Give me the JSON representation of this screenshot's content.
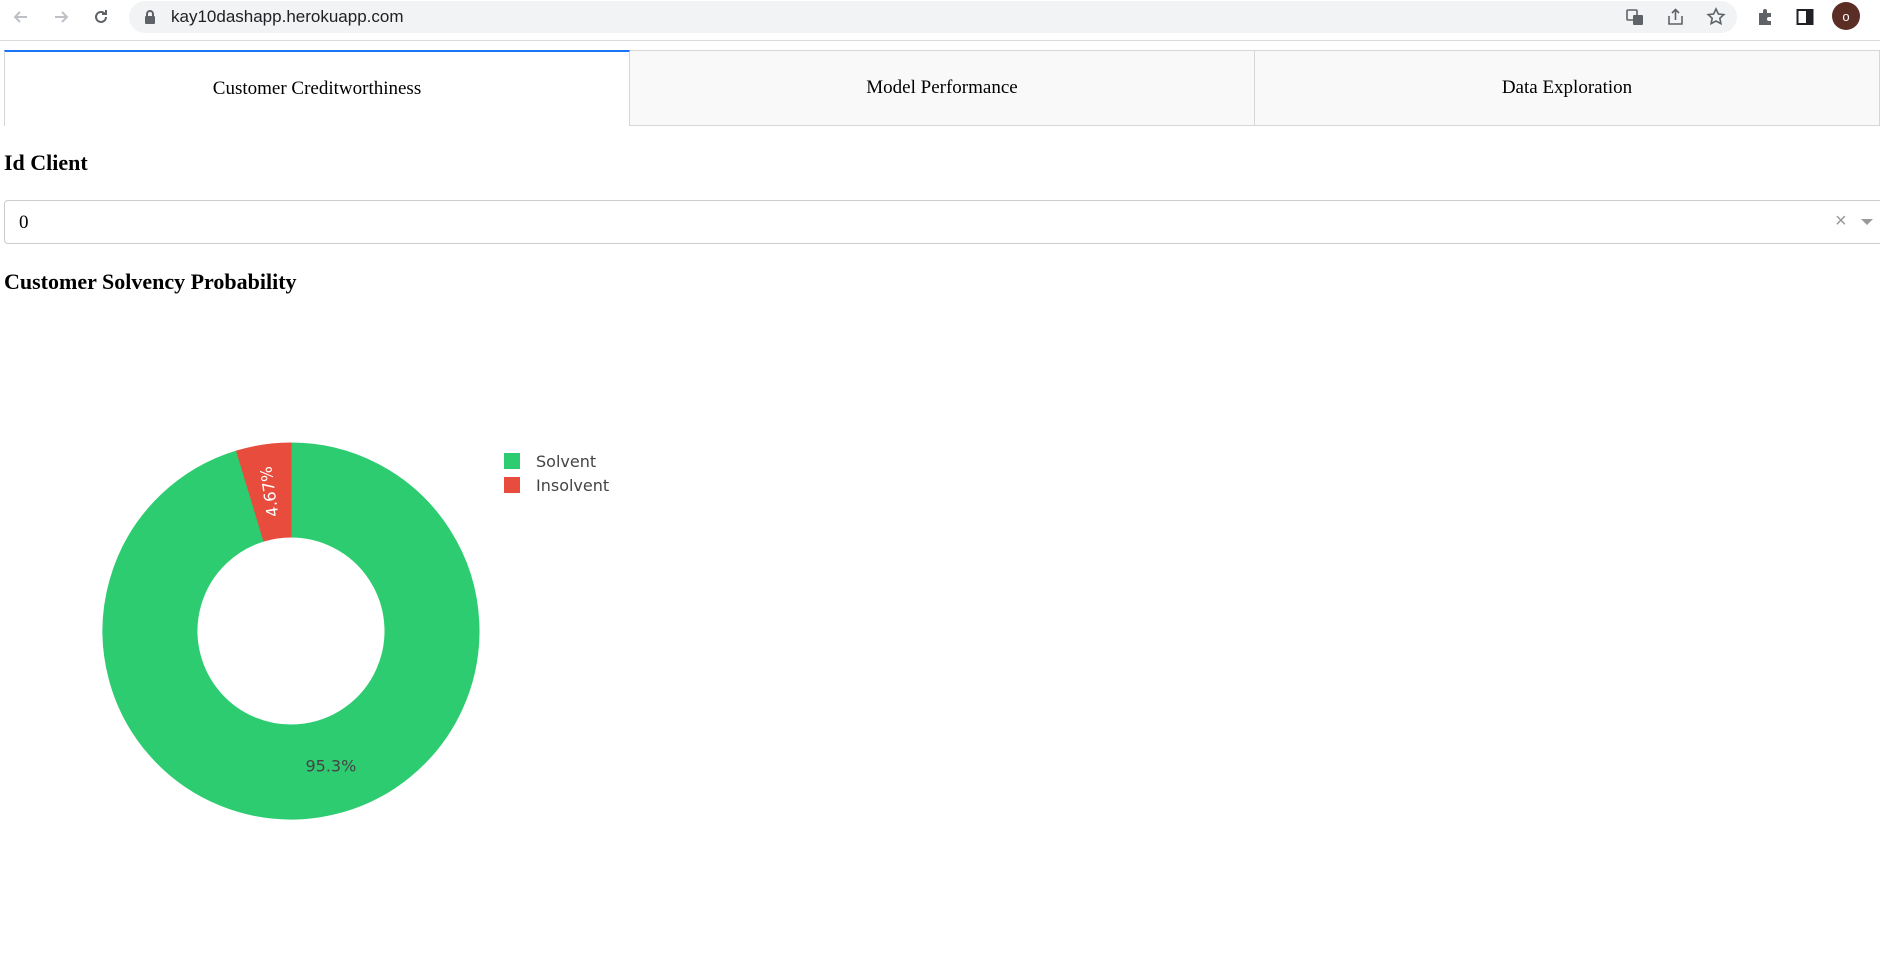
{
  "browser": {
    "url": "kay10dashapp.herokuapp.com",
    "avatar_initial": "o"
  },
  "tabs": [
    {
      "label": "Customer Creditworthiness",
      "selected": true
    },
    {
      "label": "Model Performance",
      "selected": false
    },
    {
      "label": "Data Exploration",
      "selected": false
    }
  ],
  "client_section": {
    "heading": "Id Client",
    "dropdown_value": "0"
  },
  "probability_section": {
    "heading": "Customer Solvency Probability"
  },
  "colors": {
    "solvent": "#2ecc71",
    "insolvent": "#e74c3c",
    "tab_accent": "#1975fa"
  },
  "chart_data": {
    "type": "pie",
    "hole": 0.5,
    "categories": [
      "Solvent",
      "Insolvent"
    ],
    "values": [
      95.33,
      4.67
    ],
    "labels": [
      "95.3%",
      "4.67%"
    ],
    "legend": [
      {
        "name": "Solvent",
        "color": "#2ecc71"
      },
      {
        "name": "Insolvent",
        "color": "#e74c3c"
      }
    ],
    "legend_position": "right"
  }
}
